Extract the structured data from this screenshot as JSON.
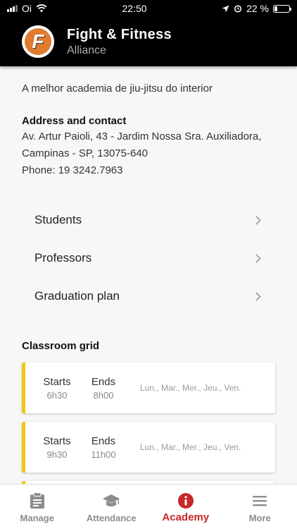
{
  "status_bar": {
    "carrier": "Oi",
    "time": "22:50",
    "battery_percent": "22 %",
    "battery_level": 0.22
  },
  "header": {
    "title": "Fight & Fitness",
    "subtitle": "Alliance",
    "logo_icon": "fight-fitness-logo"
  },
  "academy": {
    "description": "A melhor academia de jiu-jitsu do interior",
    "address_heading": "Address and contact",
    "address_line1": "Av. Artur Paioli, 43 - Jardim Nossa Sra. Auxiliadora,",
    "address_line2": "Campinas - SP, 13075-640",
    "phone": "Phone: 19 3242.7963"
  },
  "menu": {
    "items": [
      {
        "label": "Students"
      },
      {
        "label": "Professors"
      },
      {
        "label": "Graduation plan"
      }
    ]
  },
  "classroom_grid": {
    "heading": "Classroom grid",
    "starts_label": "Starts",
    "ends_label": "Ends",
    "accent_color": "#f5c518",
    "classes": [
      {
        "start": "6h30",
        "end": "8h00",
        "days": "Lun., Mar., Mer., Jeu., Ven."
      },
      {
        "start": "9h30",
        "end": "11h00",
        "days": "Lun., Mar., Mer., Jeu., Ven."
      }
    ]
  },
  "bottom_nav": {
    "active_color": "#c62828",
    "tabs": [
      {
        "label": "Manage",
        "icon": "clipboard-icon"
      },
      {
        "label": "Attendance",
        "icon": "graduation-cap-icon"
      },
      {
        "label": "Academy",
        "icon": "info-icon",
        "active": true
      },
      {
        "label": "More",
        "icon": "menu-icon"
      }
    ]
  }
}
